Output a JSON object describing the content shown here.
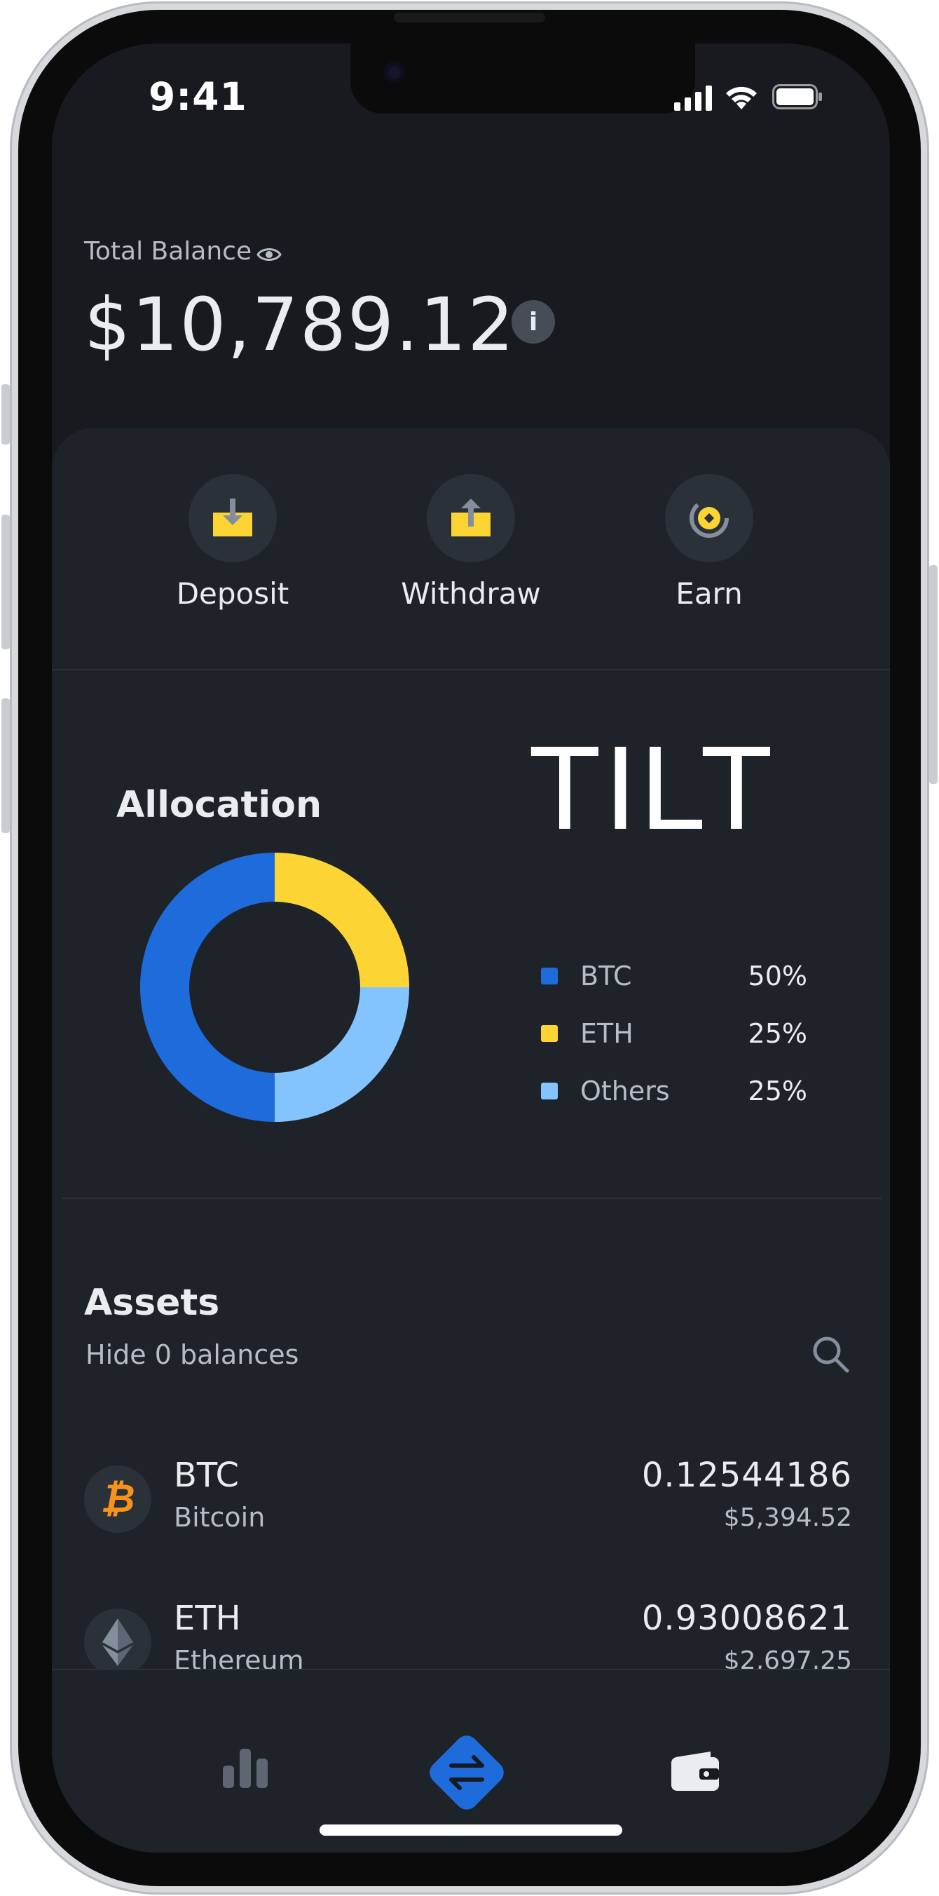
{
  "status_bar": {
    "time": "9:41"
  },
  "header": {
    "label": "Total Balance",
    "balance": "$10,789.12",
    "info_glyph": "i",
    "icons": [
      "eye-icon",
      "info-icon"
    ]
  },
  "actions": [
    {
      "label": "Deposit",
      "icon": "deposit-icon"
    },
    {
      "label": "Withdraw",
      "icon": "withdraw-icon"
    },
    {
      "label": "Earn",
      "icon": "earn-icon"
    }
  ],
  "allocation": {
    "title": "Allocation",
    "brand_text": "TILT",
    "legend": [
      {
        "name": "BTC",
        "percent": "50%",
        "color": "#1e6cdb"
      },
      {
        "name": "ETH",
        "percent": "25%",
        "color": "#fcd535"
      },
      {
        "name": "Others",
        "percent": "25%",
        "color": "#84c4fe"
      }
    ]
  },
  "chart_data": {
    "type": "pie",
    "categories": [
      "BTC",
      "ETH",
      "Others"
    ],
    "values": [
      50,
      25,
      25
    ],
    "colors": [
      "#1e6cdb",
      "#fcd535",
      "#84c4fe"
    ],
    "donut": true
  },
  "assets": {
    "title": "Assets",
    "hide_zero_label": "Hide 0 balances",
    "items": [
      {
        "symbol": "BTC",
        "name": "Bitcoin",
        "amount": "0.12544186",
        "value": "$5,394.52",
        "glyph": "₿",
        "icon": "bitcoin-icon"
      },
      {
        "symbol": "ETH",
        "name": "Ethereum",
        "amount": "0.93008621",
        "value": "$2,697.25",
        "icon": "ethereum-icon"
      }
    ]
  },
  "tabbar": {
    "items": [
      {
        "icon": "markets-chart-icon"
      },
      {
        "icon": "trade-swap-icon",
        "active": true,
        "accent": "#1e6cdb"
      },
      {
        "icon": "wallet-icon"
      }
    ]
  },
  "colors": {
    "background": "#181a20",
    "card": "#1e2329",
    "accent_yellow": "#fcd535",
    "accent_blue": "#1e6cdb"
  }
}
